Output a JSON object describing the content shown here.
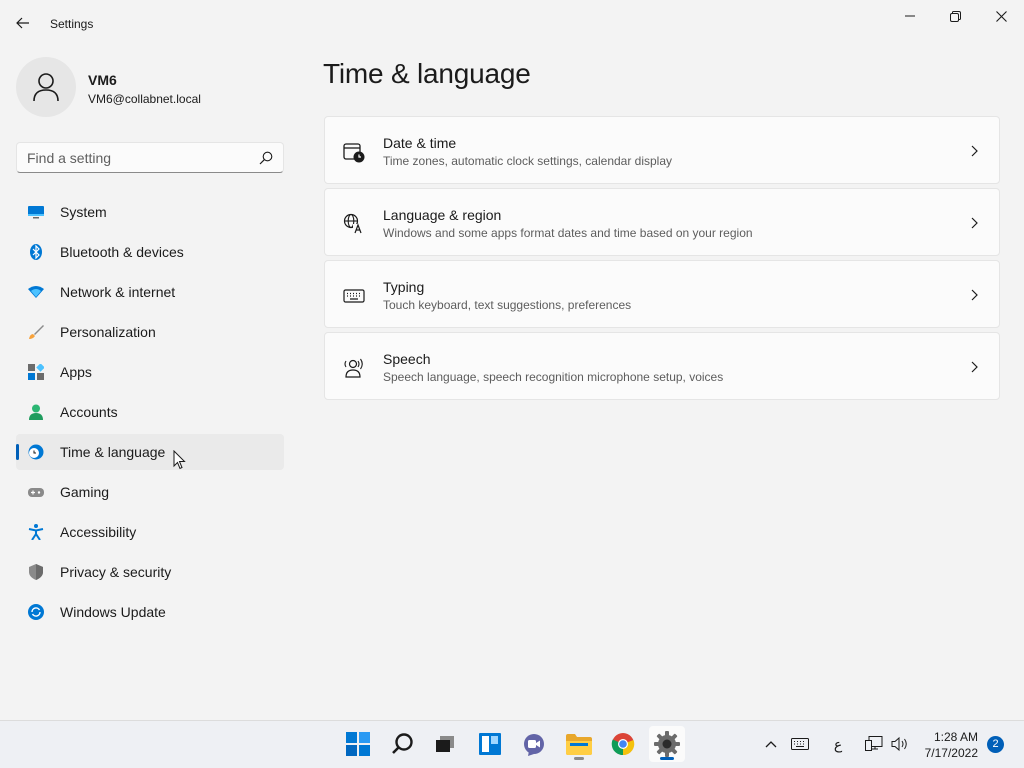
{
  "window": {
    "title": "Settings"
  },
  "profile": {
    "name": "VM6",
    "email": "VM6@collabnet.local"
  },
  "search": {
    "placeholder": "Find a setting"
  },
  "sidebar": {
    "items": [
      {
        "label": "System",
        "icon": "system-icon"
      },
      {
        "label": "Bluetooth & devices",
        "icon": "bluetooth-icon"
      },
      {
        "label": "Network & internet",
        "icon": "wifi-icon"
      },
      {
        "label": "Personalization",
        "icon": "brush-icon"
      },
      {
        "label": "Apps",
        "icon": "apps-icon"
      },
      {
        "label": "Accounts",
        "icon": "accounts-icon"
      },
      {
        "label": "Time & language",
        "icon": "globe-clock-icon",
        "selected": true
      },
      {
        "label": "Gaming",
        "icon": "gamepad-icon"
      },
      {
        "label": "Accessibility",
        "icon": "accessibility-icon"
      },
      {
        "label": "Privacy & security",
        "icon": "shield-icon"
      },
      {
        "label": "Windows Update",
        "icon": "update-icon"
      }
    ]
  },
  "main": {
    "title": "Time & language",
    "cards": [
      {
        "title": "Date & time",
        "description": "Time zones, automatic clock settings, calendar display",
        "icon": "calendar-clock-icon"
      },
      {
        "title": "Language & region",
        "description": "Windows and some apps format dates and time based on your region",
        "icon": "language-icon"
      },
      {
        "title": "Typing",
        "description": "Touch keyboard, text suggestions, preferences",
        "icon": "keyboard-icon"
      },
      {
        "title": "Speech",
        "description": "Speech language, speech recognition microphone setup, voices",
        "icon": "speech-icon"
      }
    ]
  },
  "taskbar": {
    "apps": [
      "windows-start-icon",
      "search-icon",
      "task-view-icon",
      "widgets-icon",
      "chat-icon",
      "file-explorer-icon",
      "chrome-icon",
      "settings-icon"
    ],
    "input_indicator": "ع",
    "time": "1:28 AM",
    "date": "7/17/2022",
    "notification_count": "2"
  },
  "colors": {
    "accent": "#005fb8",
    "background": "#f3f3f3",
    "card": "#fbfbfb"
  }
}
